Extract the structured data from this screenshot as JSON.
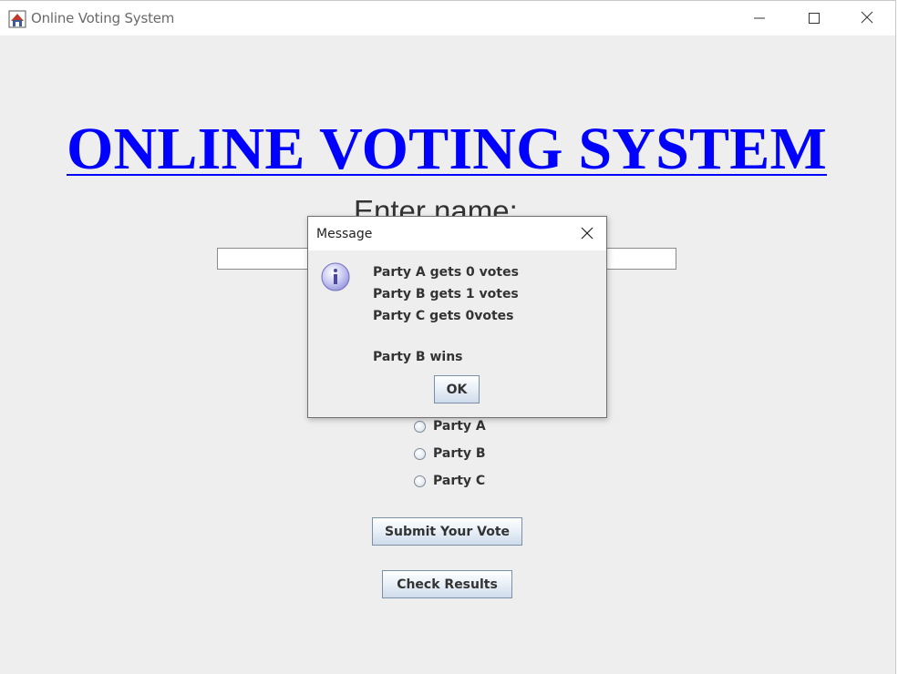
{
  "window": {
    "title": "Online Voting System",
    "controls": {
      "minimize_icon": "minimize-icon",
      "maximize_icon": "maximize-icon",
      "close_icon": "close-icon"
    }
  },
  "main": {
    "heading": "ONLINE VOTING SYSTEM",
    "name_label": "Enter name:",
    "name_input_value": "",
    "parties": [
      {
        "label": "Party A",
        "selected": false
      },
      {
        "label": "Party B",
        "selected": false
      },
      {
        "label": "Party C",
        "selected": false
      }
    ],
    "submit_label": "Submit Your Vote",
    "results_label": "Check Results"
  },
  "dialog": {
    "title": "Message",
    "icon": "info-icon",
    "lines": [
      "Party A gets 0 votes",
      "Party B gets 1 votes",
      "Party C gets 0votes",
      "Party B wins"
    ],
    "ok_label": "OK"
  },
  "colors": {
    "heading": "#0000ff",
    "background": "#eeeeee",
    "dialog_background": "#eeeeee"
  }
}
